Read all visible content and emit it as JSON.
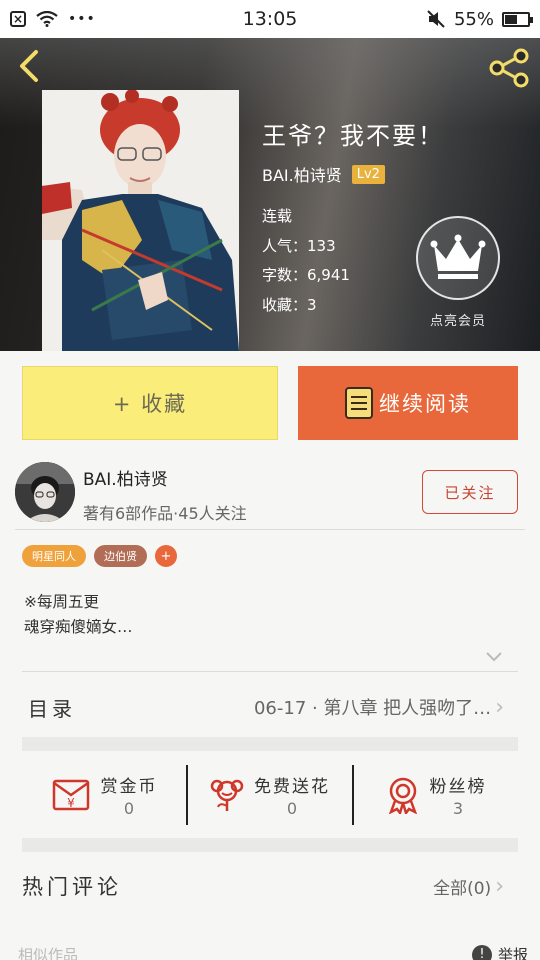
{
  "status_bar": {
    "time": "13:05",
    "battery": "55%",
    "battery_level": 0.55,
    "dots": "•••"
  },
  "book": {
    "title": "王爷？我不要！",
    "author": "BAI.柏诗贤",
    "level": "Lv2",
    "status": "连载",
    "popularity": "人气：133",
    "word_count": "字数：6,941",
    "favorites": "收藏：3",
    "vip_label": "点亮会员"
  },
  "actions": {
    "collect_label": "+ 收藏",
    "read_label": "继续阅读"
  },
  "author_row": {
    "name": "BAI.柏诗贤",
    "stats": "著有6部作品·45人关注",
    "follow_label": "已关注"
  },
  "tags": [
    {
      "label": "明星同人"
    },
    {
      "label": "边伯贤"
    },
    {
      "label": "+"
    }
  ],
  "description": {
    "line1": "※每周五更",
    "line2": "魂穿痴傻嫡女…"
  },
  "catalog": {
    "label": "目录",
    "latest": "06-17 · 第八章  把人强吻了…"
  },
  "stats": [
    {
      "label": "赏金币",
      "value": "0",
      "icon": "coin-envelope-icon"
    },
    {
      "label": "免费送花",
      "value": "0",
      "icon": "flower-icon"
    },
    {
      "label": "粉丝榜",
      "value": "3",
      "icon": "medal-icon"
    }
  ],
  "comments": {
    "title": "热门评论",
    "all_label": "全部(0)"
  },
  "footer": {
    "left": "相似作品",
    "report": "举报"
  },
  "colors": {
    "collect_bg": "#fbed79",
    "read_bg": "#e8683c",
    "accent_red": "#c94434",
    "tag_orange": "#efa23c",
    "tag_brown": "#b26d56",
    "level_badge": "#e8b23c",
    "share_icon": "#f3dc6a"
  }
}
